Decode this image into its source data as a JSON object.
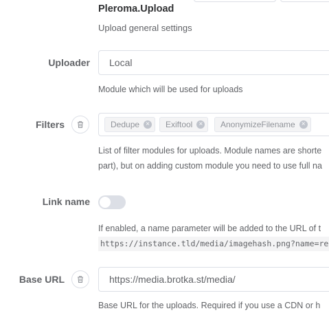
{
  "section": {
    "title": "Pleroma.Upload",
    "description": "Upload general settings"
  },
  "uploader": {
    "label": "Uploader",
    "value": "Local",
    "description": "Module which will be used for uploads"
  },
  "filters": {
    "label": "Filters",
    "tags": [
      "Dedupe",
      "Exiftool",
      "AnonymizeFilename"
    ],
    "description_line1": "List of filter modules for uploads. Module names are shorte",
    "description_line2": "part), but on adding custom module you need to use full na"
  },
  "link_name": {
    "label": "Link name",
    "enabled": false,
    "description": "If enabled, a name parameter will be added to the URL of t",
    "example": "https://instance.tld/media/imagehash.png?name=realname"
  },
  "base_url": {
    "label": "Base URL",
    "value": "https://media.brotka.st/media/",
    "description": "Base URL for the uploads. Required if you use a CDN or h"
  },
  "icons": {
    "delete": "trash-icon",
    "tag_remove": "close-circle-icon"
  },
  "colors": {
    "border": "#dcdfe6",
    "tag_bg": "#f4f4f5",
    "text": "#606266"
  }
}
